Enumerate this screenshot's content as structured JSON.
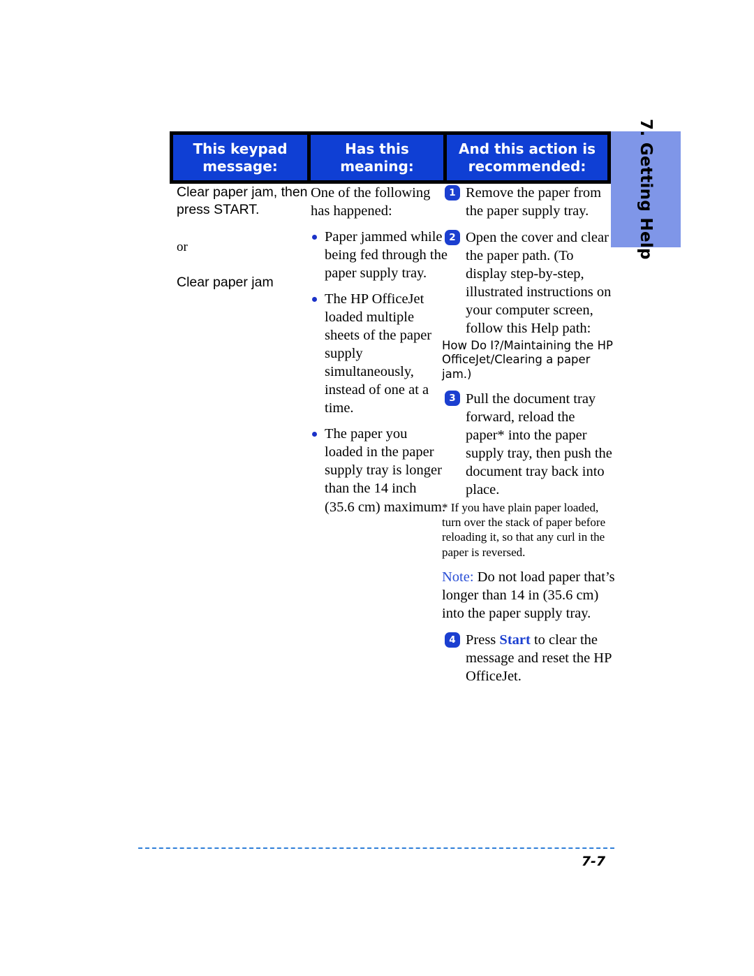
{
  "side_tab": {
    "label": "7. Getting Help",
    "background_color": "#7f96e8"
  },
  "table": {
    "header_background": "#0f3fd4",
    "headers": [
      "This keypad message:",
      "Has this meaning:",
      "And this action is recommended:"
    ],
    "row": {
      "message": {
        "first": "Clear paper jam, then press START.",
        "or": "or",
        "second": "Clear paper jam"
      },
      "meaning": {
        "intro": "One of the following has happened:",
        "bullets": [
          "Paper jammed while being fed through the paper supply tray.",
          "The HP OfficeJet loaded multiple sheets of the paper supply simultaneously, instead of one at a time.",
          "The paper you loaded in the paper supply tray is longer than the 14 inch (35.6 cm) maximum."
        ],
        "bullet_color": "#1b32c8"
      },
      "action": {
        "steps": [
          {
            "num": "1",
            "text": "Remove the paper from the paper supply tray."
          },
          {
            "num": "2",
            "text": "Open the cover and clear the paper path. (To display step-by-step, illustrated instructions on your computer screen, follow this Help path:"
          },
          {
            "num": "3",
            "text": "Pull the document tray forward, reload the paper* into the paper supply tray, then push the document tray back into place."
          },
          {
            "num": "4",
            "text_before": "Press ",
            "keyword": "Start",
            "text_after": " to clear the message and reset the HP OfficeJet."
          }
        ],
        "help_path": "How Do I?/Maintaining the HP OfficeJet/Clearing a paper jam.)",
        "footnote": "* If you have plain paper loaded, turn over the stack of paper before reloading it, so that any curl in the paper is reversed.",
        "note_label": "Note:",
        "note_text": " Do not load paper that’s longer than 14 in (35.6 cm) into the paper supply tray.",
        "step_marker_color": "#1b3fd0",
        "keyword_color": "#1b3fd0",
        "note_label_color": "#2a4fd6"
      }
    }
  },
  "footer": {
    "page_number": "7-7",
    "rule_color": "#2f7fd8"
  }
}
